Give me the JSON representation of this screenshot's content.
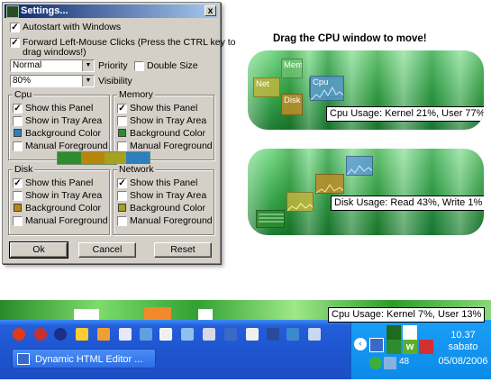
{
  "settings": {
    "title": "Settings...",
    "close": "x",
    "autostart": "Autostart with Windows",
    "forward_line1": "Forward Left-Mouse Clicks (Press the CTRL key to",
    "forward_line2": "drag windows!)",
    "priority_value": "Normal",
    "priority_label": "Priority",
    "double_size": "Double Size",
    "visibility_value": "80%",
    "visibility_label": "Visibility",
    "cpu_group": {
      "title": "Cpu",
      "show_panel": "Show this Panel",
      "tray": "Show in Tray Area",
      "bg": "Background Color",
      "fg": "Manual Foreground",
      "color": "#2f7fbf"
    },
    "memory_group": {
      "title": "Memory",
      "show_panel": "Show this Panel",
      "tray": "Show in Tray Area",
      "bg": "Background Color",
      "fg": "Manual Foreground",
      "color": "#2e8b2e"
    },
    "disk_group": {
      "title": "Disk",
      "show_panel": "Show this Panel",
      "tray": "Show in Tray Area",
      "bg": "Background Color",
      "fg": "Manual Foreground",
      "color": "#b8860b"
    },
    "network_group": {
      "title": "Network",
      "show_panel": "Show this Panel",
      "tray": "Show in Tray Area",
      "bg": "Background Color",
      "fg": "Manual Foreground",
      "color": "#a8a020"
    },
    "ok": "Ok",
    "cancel": "Cancel",
    "reset": "Reset"
  },
  "headline": "Drag the CPU window to move!",
  "panel1": {
    "tiles": [
      "Mem",
      "Net",
      "Cpu",
      "Disk"
    ],
    "tooltip": "Cpu Usage: Kernel 21%, User 77%"
  },
  "panel2": {
    "tooltip": "Disk Usage: Read 43%, Write 1%"
  },
  "taskbar": {
    "tooltip": "Cpu Usage: Kernel 7%, User 13%",
    "task_button": "Dynamic HTML Editor ...",
    "time": "10.37",
    "day": "sabato",
    "date": "05/08/2006",
    "tray_number": "48"
  },
  "colors": {
    "cpu": "#2f7fbf",
    "memory": "#2e8b2e",
    "disk": "#b8860b",
    "network": "#a8a020",
    "taskbar": "#245edb"
  }
}
